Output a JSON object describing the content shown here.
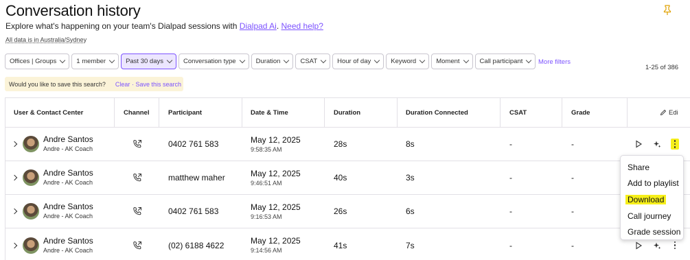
{
  "header": {
    "title": "Conversation history",
    "subtitle_prefix": "Explore what's happening on your team's Dialpad sessions with ",
    "dialpad_ai_link": "Dialpad Ai",
    "help_link": "Need help?",
    "timezone_note": "All data is in Australia/Sydney"
  },
  "filters": {
    "chips": [
      {
        "label": "Offices | Groups",
        "active": false
      },
      {
        "label": "1 member",
        "active": false
      },
      {
        "label": "Past 30 days",
        "active": true
      },
      {
        "label": "Conversation type",
        "active": false
      },
      {
        "label": "Duration",
        "active": false
      },
      {
        "label": "CSAT",
        "active": false
      },
      {
        "label": "Hour of day",
        "active": false
      },
      {
        "label": "Keyword",
        "active": false
      },
      {
        "label": "Moment",
        "active": false
      },
      {
        "label": "Call participant",
        "active": false
      }
    ],
    "more_filters": "More filters",
    "result_count": "1-25 of 386"
  },
  "save_search": {
    "prompt": "Would you like to save this search?",
    "clear": "Clear",
    "separator": "·",
    "save": "Save this search"
  },
  "table": {
    "columns": [
      "User & Contact Center",
      "Channel",
      "Participant",
      "Date & Time",
      "Duration",
      "Duration Connected",
      "CSAT",
      "Grade"
    ],
    "edit_label": "Edi",
    "rows": [
      {
        "user": "Andre Santos",
        "team": "Andre - AK Coach",
        "participant": "0402 761 583",
        "date": "May 12, 2025",
        "time": "9:58:35 AM",
        "duration": "28s",
        "connected": "8s",
        "csat": "-",
        "grade": "-"
      },
      {
        "user": "Andre Santos",
        "team": "Andre - AK Coach",
        "participant": "matthew maher",
        "date": "May 12, 2025",
        "time": "9:46:51 AM",
        "duration": "40s",
        "connected": "3s",
        "csat": "-",
        "grade": "-"
      },
      {
        "user": "Andre Santos",
        "team": "Andre - AK Coach",
        "participant": "0402 761 583",
        "date": "May 12, 2025",
        "time": "9:16:53 AM",
        "duration": "26s",
        "connected": "6s",
        "csat": "-",
        "grade": "-"
      },
      {
        "user": "Andre Santos",
        "team": "Andre - AK Coach",
        "participant": "(02) 6188 4622",
        "date": "May 12, 2025",
        "time": "9:14:56 AM",
        "duration": "41s",
        "connected": "7s",
        "csat": "-",
        "grade": "-"
      }
    ]
  },
  "row_menu": {
    "items": [
      "Share",
      "Add to playlist",
      "Download",
      "Call journey",
      "Grade session"
    ],
    "highlighted": "Download"
  },
  "icons": {
    "channel": "phone-outgoing-icon",
    "play": "play-icon",
    "ai": "sparkle-icon",
    "more": "more-vertical-icon",
    "pin": "pin-icon",
    "edit": "pencil-icon"
  },
  "colors": {
    "accent": "#7c52ff",
    "active_chip_bg": "#ece6ff",
    "save_bar_bg": "#fbf3d8",
    "highlight": "#f6ef1a"
  }
}
